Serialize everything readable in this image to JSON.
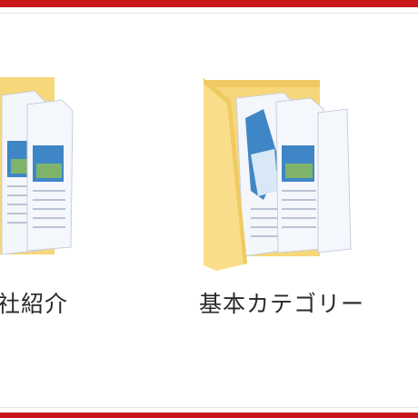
{
  "folders": [
    {
      "name": "社紹介"
    },
    {
      "name": "基本カテゴリー"
    }
  ],
  "colors": {
    "frame": "#c8161d",
    "folder_back": "#f6d77a",
    "folder_front": "#f9dd8a",
    "paper": "#f3f6fb"
  },
  "icons": [
    "folder-icon",
    "document-icon"
  ]
}
